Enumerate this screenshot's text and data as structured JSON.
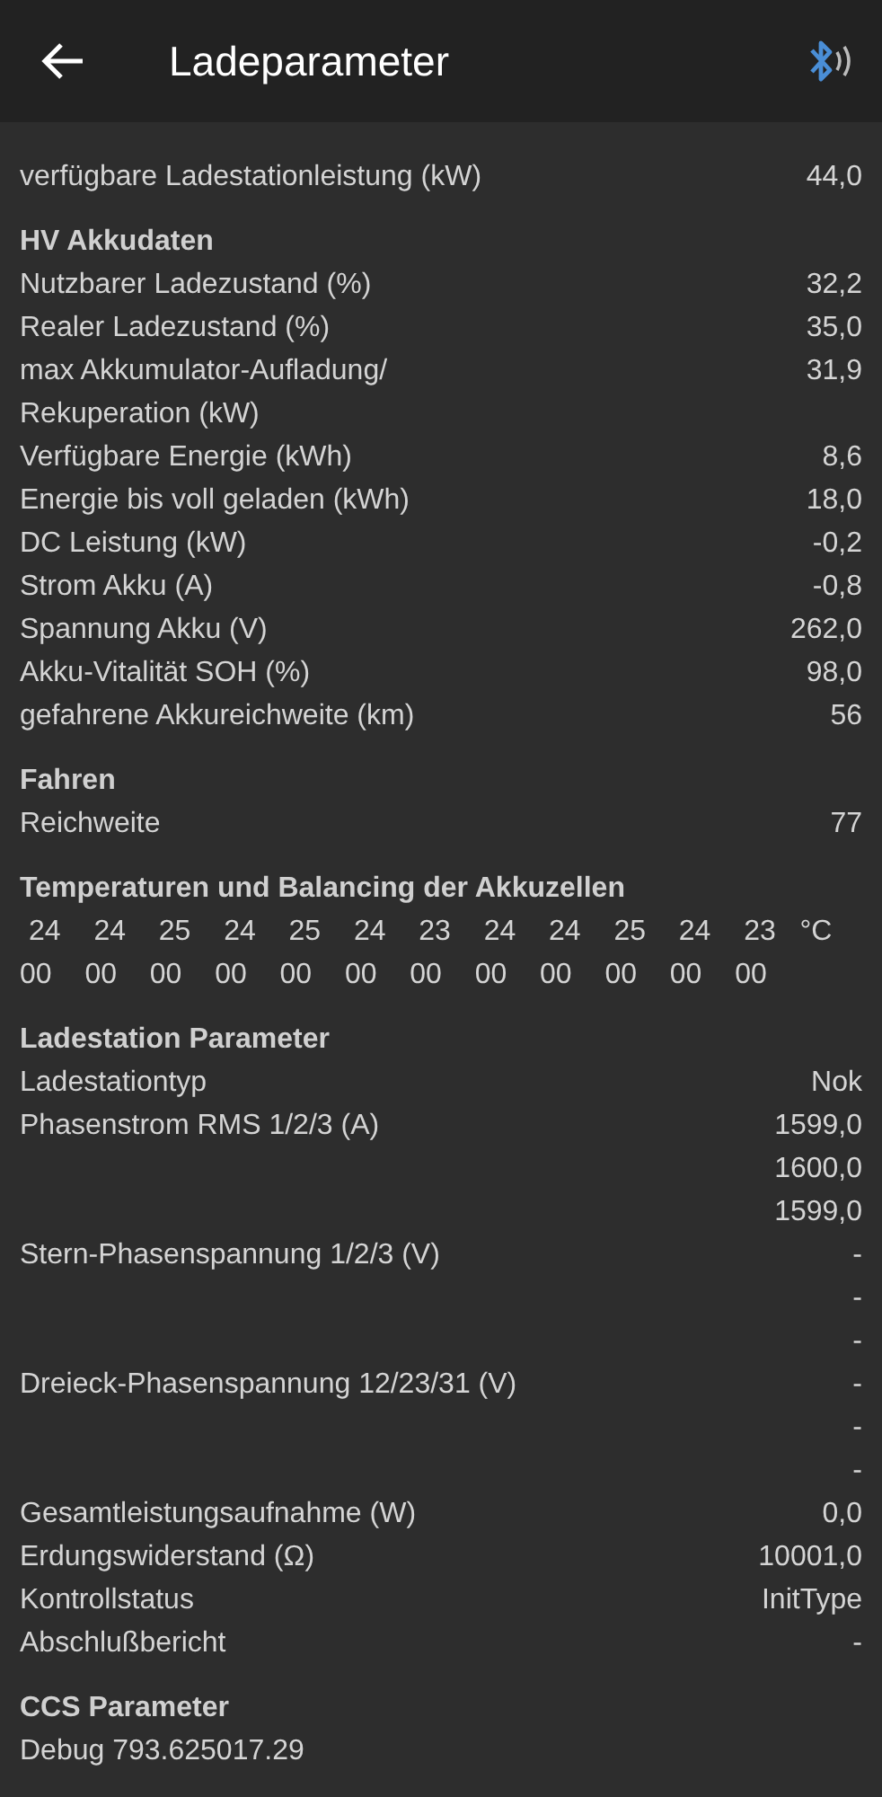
{
  "app_bar": {
    "title": "Ladeparameter"
  },
  "sections": [
    {
      "kind": "rows",
      "rows": [
        {
          "label": "verfügbare Ladestationleistung (kW)",
          "values": [
            "44,0"
          ]
        }
      ]
    },
    {
      "kind": "rows",
      "title": "HV Akkudaten",
      "rows": [
        {
          "label": "Nutzbarer Ladezustand (%)",
          "values": [
            "32,2"
          ]
        },
        {
          "label": "Realer Ladezustand (%)",
          "values": [
            "35,0"
          ]
        },
        {
          "label": "max Akkumulator-Aufladung/ Rekuperation (kW)",
          "values": [
            "31,9"
          ]
        },
        {
          "label": "Verfügbare Energie (kWh)",
          "values": [
            "8,6"
          ]
        },
        {
          "label": "Energie bis voll geladen (kWh)",
          "values": [
            "18,0"
          ]
        },
        {
          "label": "DC Leistung (kW)",
          "values": [
            "-0,2"
          ]
        },
        {
          "label": "Strom Akku (A)",
          "values": [
            "-0,8"
          ]
        },
        {
          "label": "Spannung Akku (V)",
          "values": [
            "262,0"
          ]
        },
        {
          "label": "Akku-Vitalität SOH (%)",
          "values": [
            "98,0"
          ]
        },
        {
          "label": "gefahrene Akkureichweite (km)",
          "values": [
            "56"
          ]
        }
      ]
    },
    {
      "kind": "rows",
      "title": "Fahren",
      "rows": [
        {
          "label": "Reichweite",
          "values": [
            "77"
          ]
        }
      ]
    },
    {
      "kind": "cells",
      "title": "Temperaturen und Balancing der Akkuzellen",
      "temperatures": [
        "24",
        "24",
        "25",
        "24",
        "25",
        "24",
        "23",
        "24",
        "24",
        "25",
        "24",
        "23"
      ],
      "unit": "°C",
      "balancing": [
        "00",
        "00",
        "00",
        "00",
        "00",
        "00",
        "00",
        "00",
        "00",
        "00",
        "00",
        "00"
      ]
    },
    {
      "kind": "rows",
      "title": "Ladestation Parameter",
      "rows": [
        {
          "label": "Ladestationtyp",
          "values": [
            "Nok"
          ]
        },
        {
          "label": "Phasenstrom RMS 1/2/3 (A)",
          "values": [
            "1599,0",
            "1600,0",
            "1599,0"
          ]
        },
        {
          "label": "Stern-Phasenspannung 1/2/3 (V)",
          "values": [
            "-",
            "-",
            "-"
          ]
        },
        {
          "label": "Dreieck-Phasenspannung 12/23/31 (V)",
          "values": [
            "-",
            "-",
            "-"
          ]
        },
        {
          "label": "Gesamtleistungsaufnahme (W)",
          "values": [
            "0,0"
          ]
        },
        {
          "label": "Erdungswiderstand (Ω)",
          "values": [
            "10001,0"
          ]
        },
        {
          "label": "Kontrollstatus",
          "values": [
            "InitType"
          ]
        },
        {
          "label": "Abschlußbericht",
          "values": [
            "-"
          ]
        }
      ]
    },
    {
      "kind": "text",
      "title": "CCS Parameter",
      "text": "Debug 793.625017.29"
    }
  ]
}
